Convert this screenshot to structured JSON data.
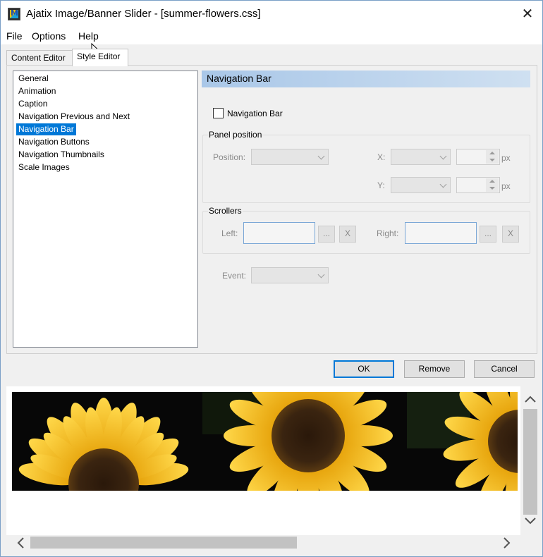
{
  "window": {
    "title": "Ajatix Image/Banner Slider - [summer-flowers.css]",
    "close_glyph": "✕"
  },
  "menu": {
    "file": "File",
    "options": "Options",
    "help": "Help"
  },
  "tabs": {
    "content_editor": "Content Editor",
    "style_editor": "Style Editor"
  },
  "tree": {
    "items": [
      "General",
      "Animation",
      "Caption",
      "Navigation Previous and Next",
      "Navigation Bar",
      "Navigation Buttons",
      "Navigation Thumbnails",
      "Scale Images"
    ],
    "selected": "Navigation Bar"
  },
  "section": {
    "title": "Navigation Bar",
    "checkbox_label": "Navigation Bar",
    "checkbox_checked": false
  },
  "panel_position": {
    "group_label": "Panel position",
    "position_label": "Position:",
    "x_label": "X:",
    "y_label": "Y:",
    "x_unit": "px",
    "y_unit": "px"
  },
  "scrollers": {
    "group_label": "Scrollers",
    "left_label": "Left:",
    "right_label": "Right:",
    "browse": "...",
    "clear": "X"
  },
  "event": {
    "label": "Event:"
  },
  "buttons": {
    "ok": "OK",
    "remove": "Remove",
    "cancel": "Cancel"
  },
  "colors": {
    "selection": "#0078d7",
    "header_gradient_start": "#a9c7e8",
    "header_gradient_end": "#cfe0f1",
    "petal": "#f5b800",
    "flower_center": "#3a2410"
  },
  "icons": {
    "app": "ajatix-app-icon",
    "close": "close-icon",
    "scroll_up": "chevron-up-icon",
    "scroll_down": "chevron-down-icon",
    "scroll_left": "chevron-left-icon",
    "scroll_right": "chevron-right-icon"
  }
}
